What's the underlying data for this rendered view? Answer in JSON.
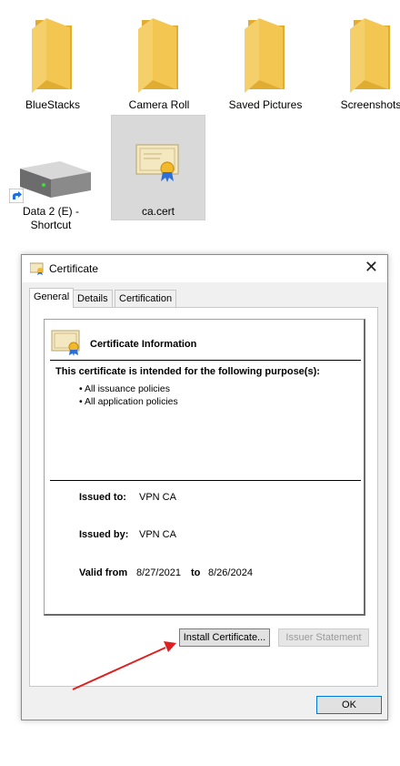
{
  "desktop": {
    "items": [
      {
        "label": "BlueStacks"
      },
      {
        "label": "Camera Roll"
      },
      {
        "label": "Saved Pictures"
      },
      {
        "label": "Screenshots"
      },
      {
        "label": "Data 2 (E) -"
      },
      {
        "label": "Shortcut"
      },
      {
        "label": "ca.cert"
      }
    ]
  },
  "dialog": {
    "title": "Certificate",
    "close_label": "✕",
    "tabs": [
      "General",
      "Details",
      "Certification Path"
    ],
    "info_title": "Certificate Information",
    "purpose_heading": "This certificate is intended for the following purpose(s):",
    "purposes": [
      "• All issuance policies",
      "• All application policies"
    ],
    "issued_to_label": "Issued to:",
    "issued_to_value": "VPN CA",
    "issued_by_label": "Issued by:",
    "issued_by_value": "VPN CA",
    "valid_from_label": "Valid from",
    "valid_from_value": "8/27/2021",
    "valid_to_label": "to",
    "valid_to_value": "8/26/2024",
    "install_button": "Install Certificate...",
    "issuer_button": "Issuer Statement",
    "ok_button": "OK"
  },
  "colors": {
    "folder": "#f3c651",
    "folder_dark": "#e0ad32",
    "arrow": "#e02020",
    "ok_border": "#0078d7"
  }
}
